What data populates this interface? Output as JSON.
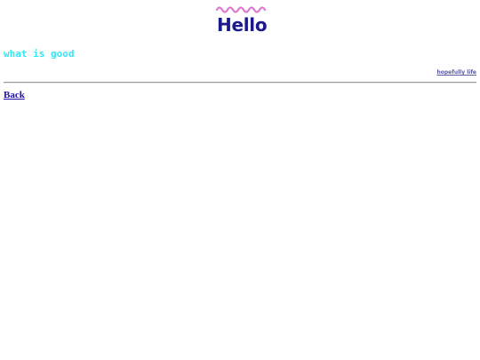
{
  "header": {
    "logo_text": "Hello",
    "logo_wave_color": "#e07ad0",
    "logo_text_color": "#1a1a8c"
  },
  "tagline": "what is good",
  "small_note": "hopefully life",
  "nav": {
    "back_label": "Back"
  },
  "colors": {
    "tagline": "#33e6f0",
    "link": "#1a0dab"
  }
}
